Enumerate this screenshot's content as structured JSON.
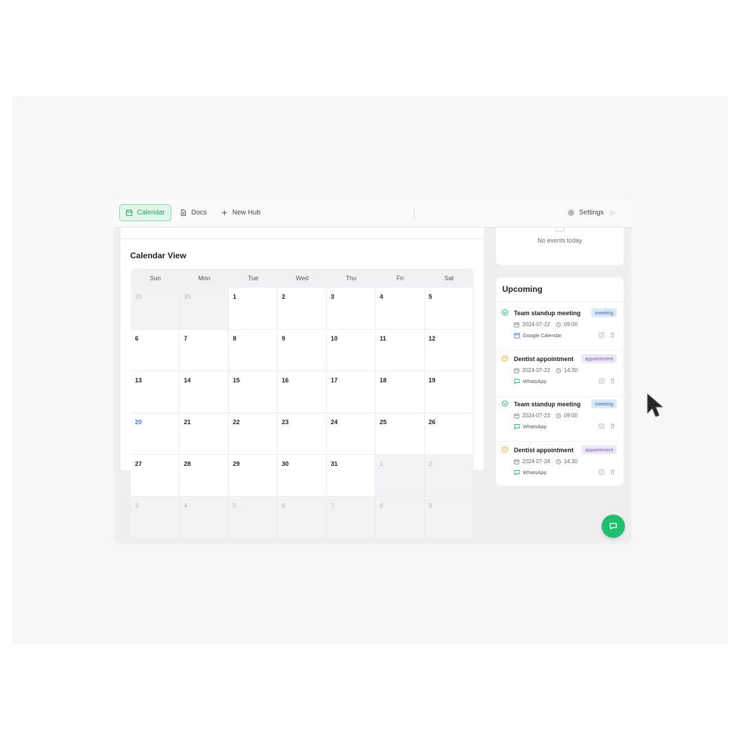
{
  "colors": {
    "accent": "#1f9d5c",
    "accent_bg": "#e3f6ec",
    "today": "#3b7bd8",
    "fab": "#1fbf6f",
    "meeting_tag": "#dbe8fb",
    "appointment_tag": "#ede8f8"
  },
  "tabs": {
    "calendar": {
      "label": "Calendar",
      "icon": "calendar-icon"
    },
    "docs": {
      "label": "Docs",
      "icon": "document-icon"
    },
    "new_hub": {
      "label": "New Hub",
      "icon": "plus-icon"
    },
    "settings": {
      "label": "Settings",
      "icon": "gear-icon"
    }
  },
  "calendar": {
    "title": "Calendar View",
    "days_of_week": [
      "Sun",
      "Mon",
      "Tue",
      "Wed",
      "Thu",
      "Fri",
      "Sat"
    ],
    "weeks": [
      [
        "29",
        "30",
        "1",
        "2",
        "3",
        "4",
        "5"
      ],
      [
        "6",
        "7",
        "8",
        "9",
        "10",
        "11",
        "12"
      ],
      [
        "13",
        "14",
        "15",
        "16",
        "17",
        "18",
        "19"
      ],
      [
        "20",
        "21",
        "22",
        "23",
        "24",
        "25",
        "26"
      ],
      [
        "27",
        "28",
        "29",
        "30",
        "31",
        "1",
        "2"
      ],
      [
        "3",
        "4",
        "5",
        "6",
        "7",
        "8",
        "9"
      ]
    ]
  },
  "today_panel": {
    "empty_text": "No events today"
  },
  "upcoming": {
    "title": "Upcoming",
    "events": [
      {
        "title": "Team standup meeting",
        "tag": "meeting",
        "date": "2024-07-22",
        "time": "09:00",
        "source": "Google Calendar",
        "status_icon": "check-circle-icon",
        "source_icon": "calendar-icon"
      },
      {
        "title": "Dentist appointment",
        "tag": "appointment",
        "date": "2024-07-22",
        "time": "14:30",
        "source": "WhatsApp",
        "status_icon": "clock-icon",
        "source_icon": "chat-icon"
      },
      {
        "title": "Team standup meeting",
        "tag": "meeting",
        "date": "2024-07-23",
        "time": "09:00",
        "source": "WhatsApp",
        "status_icon": "check-circle-icon",
        "source_icon": "chat-icon"
      },
      {
        "title": "Dentist appointment",
        "tag": "appointment",
        "date": "2024-07-24",
        "time": "14:30",
        "source": "WhatsApp",
        "status_icon": "clock-icon",
        "source_icon": "chat-icon"
      }
    ]
  }
}
